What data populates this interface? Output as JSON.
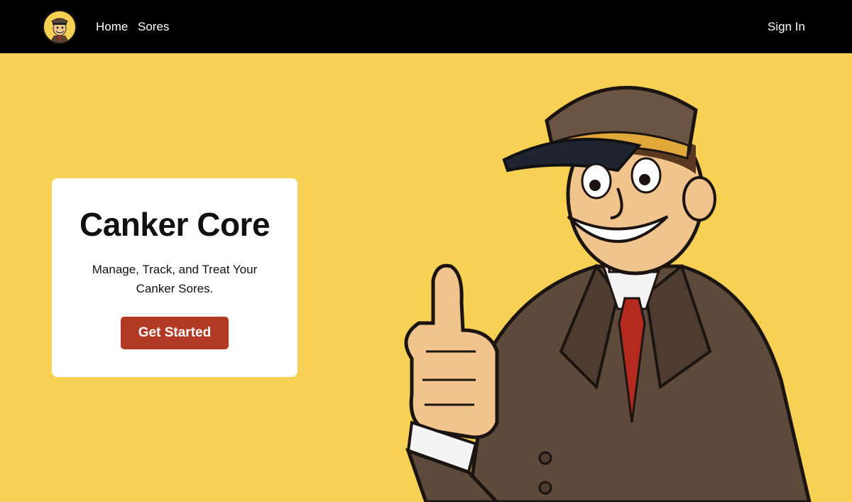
{
  "nav": {
    "logo_icon": "mascot-logo-icon",
    "links": [
      {
        "label": "Home"
      },
      {
        "label": "Sores"
      }
    ],
    "signin_label": "Sign In"
  },
  "hero": {
    "title": "Canker Core",
    "subtitle": "Manage, Track, and Treat Your Canker Sores.",
    "cta_label": "Get Started"
  },
  "colors": {
    "background": "#f7d154",
    "navbar": "#000000",
    "cta": "#b23a25",
    "card": "#ffffff"
  },
  "illustration": {
    "icon": "thumbs-up-mascot-illustration"
  }
}
